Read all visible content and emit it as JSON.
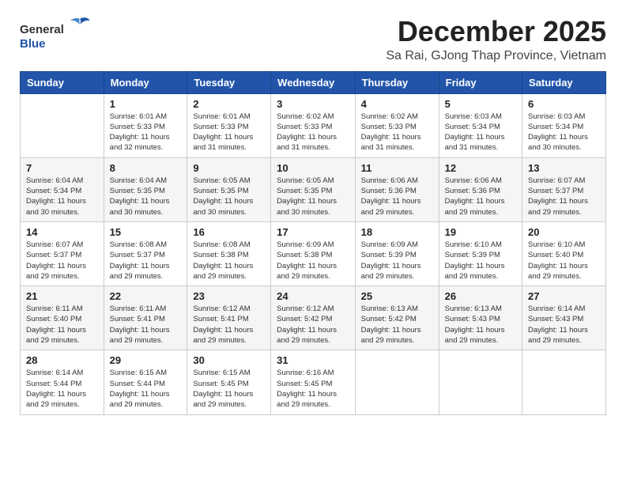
{
  "header": {
    "logo_general": "General",
    "logo_blue": "Blue",
    "month_title": "December 2025",
    "subtitle": "Sa Rai, GJong Thap Province, Vietnam"
  },
  "weekdays": [
    "Sunday",
    "Monday",
    "Tuesday",
    "Wednesday",
    "Thursday",
    "Friday",
    "Saturday"
  ],
  "weeks": [
    [
      {
        "day": "",
        "info": ""
      },
      {
        "day": "1",
        "info": "Sunrise: 6:01 AM\nSunset: 5:33 PM\nDaylight: 11 hours\nand 32 minutes."
      },
      {
        "day": "2",
        "info": "Sunrise: 6:01 AM\nSunset: 5:33 PM\nDaylight: 11 hours\nand 31 minutes."
      },
      {
        "day": "3",
        "info": "Sunrise: 6:02 AM\nSunset: 5:33 PM\nDaylight: 11 hours\nand 31 minutes."
      },
      {
        "day": "4",
        "info": "Sunrise: 6:02 AM\nSunset: 5:33 PM\nDaylight: 11 hours\nand 31 minutes."
      },
      {
        "day": "5",
        "info": "Sunrise: 6:03 AM\nSunset: 5:34 PM\nDaylight: 11 hours\nand 31 minutes."
      },
      {
        "day": "6",
        "info": "Sunrise: 6:03 AM\nSunset: 5:34 PM\nDaylight: 11 hours\nand 30 minutes."
      }
    ],
    [
      {
        "day": "7",
        "info": "Sunrise: 6:04 AM\nSunset: 5:34 PM\nDaylight: 11 hours\nand 30 minutes."
      },
      {
        "day": "8",
        "info": "Sunrise: 6:04 AM\nSunset: 5:35 PM\nDaylight: 11 hours\nand 30 minutes."
      },
      {
        "day": "9",
        "info": "Sunrise: 6:05 AM\nSunset: 5:35 PM\nDaylight: 11 hours\nand 30 minutes."
      },
      {
        "day": "10",
        "info": "Sunrise: 6:05 AM\nSunset: 5:35 PM\nDaylight: 11 hours\nand 30 minutes."
      },
      {
        "day": "11",
        "info": "Sunrise: 6:06 AM\nSunset: 5:36 PM\nDaylight: 11 hours\nand 29 minutes."
      },
      {
        "day": "12",
        "info": "Sunrise: 6:06 AM\nSunset: 5:36 PM\nDaylight: 11 hours\nand 29 minutes."
      },
      {
        "day": "13",
        "info": "Sunrise: 6:07 AM\nSunset: 5:37 PM\nDaylight: 11 hours\nand 29 minutes."
      }
    ],
    [
      {
        "day": "14",
        "info": "Sunrise: 6:07 AM\nSunset: 5:37 PM\nDaylight: 11 hours\nand 29 minutes."
      },
      {
        "day": "15",
        "info": "Sunrise: 6:08 AM\nSunset: 5:37 PM\nDaylight: 11 hours\nand 29 minutes."
      },
      {
        "day": "16",
        "info": "Sunrise: 6:08 AM\nSunset: 5:38 PM\nDaylight: 11 hours\nand 29 minutes."
      },
      {
        "day": "17",
        "info": "Sunrise: 6:09 AM\nSunset: 5:38 PM\nDaylight: 11 hours\nand 29 minutes."
      },
      {
        "day": "18",
        "info": "Sunrise: 6:09 AM\nSunset: 5:39 PM\nDaylight: 11 hours\nand 29 minutes."
      },
      {
        "day": "19",
        "info": "Sunrise: 6:10 AM\nSunset: 5:39 PM\nDaylight: 11 hours\nand 29 minutes."
      },
      {
        "day": "20",
        "info": "Sunrise: 6:10 AM\nSunset: 5:40 PM\nDaylight: 11 hours\nand 29 minutes."
      }
    ],
    [
      {
        "day": "21",
        "info": "Sunrise: 6:11 AM\nSunset: 5:40 PM\nDaylight: 11 hours\nand 29 minutes."
      },
      {
        "day": "22",
        "info": "Sunrise: 6:11 AM\nSunset: 5:41 PM\nDaylight: 11 hours\nand 29 minutes."
      },
      {
        "day": "23",
        "info": "Sunrise: 6:12 AM\nSunset: 5:41 PM\nDaylight: 11 hours\nand 29 minutes."
      },
      {
        "day": "24",
        "info": "Sunrise: 6:12 AM\nSunset: 5:42 PM\nDaylight: 11 hours\nand 29 minutes."
      },
      {
        "day": "25",
        "info": "Sunrise: 6:13 AM\nSunset: 5:42 PM\nDaylight: 11 hours\nand 29 minutes."
      },
      {
        "day": "26",
        "info": "Sunrise: 6:13 AM\nSunset: 5:43 PM\nDaylight: 11 hours\nand 29 minutes."
      },
      {
        "day": "27",
        "info": "Sunrise: 6:14 AM\nSunset: 5:43 PM\nDaylight: 11 hours\nand 29 minutes."
      }
    ],
    [
      {
        "day": "28",
        "info": "Sunrise: 6:14 AM\nSunset: 5:44 PM\nDaylight: 11 hours\nand 29 minutes."
      },
      {
        "day": "29",
        "info": "Sunrise: 6:15 AM\nSunset: 5:44 PM\nDaylight: 11 hours\nand 29 minutes."
      },
      {
        "day": "30",
        "info": "Sunrise: 6:15 AM\nSunset: 5:45 PM\nDaylight: 11 hours\nand 29 minutes."
      },
      {
        "day": "31",
        "info": "Sunrise: 6:16 AM\nSunset: 5:45 PM\nDaylight: 11 hours\nand 29 minutes."
      },
      {
        "day": "",
        "info": ""
      },
      {
        "day": "",
        "info": ""
      },
      {
        "day": "",
        "info": ""
      }
    ]
  ]
}
